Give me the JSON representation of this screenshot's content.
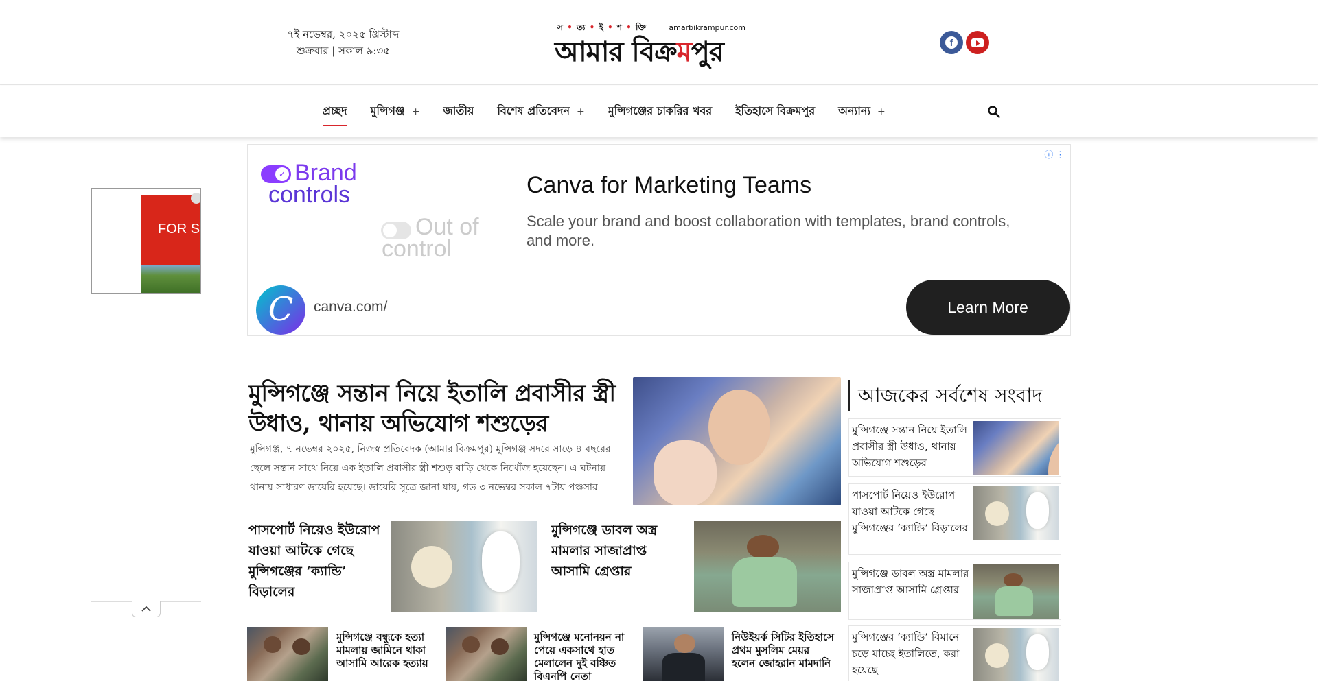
{
  "header": {
    "date_line": "৭ই নভেম্বর, ২০২৫ খ্রিস্টাব্দ",
    "time_line": "শুক্রবার | সকাল ৯:৩৫",
    "logo_tagline": [
      "স",
      "ত্য",
      "ই",
      "শ",
      "ক্তি"
    ],
    "logo_url": "amarbikrampur.com",
    "logo_text_a": "আমার বিক্র",
    "logo_text_b": "ম",
    "logo_text_c": "পুর",
    "social": [
      "facebook-icon",
      "youtube-icon"
    ]
  },
  "nav": {
    "items": [
      {
        "label": "প্রচ্ছদ",
        "plus": ""
      },
      {
        "label": "মুন্সিগঞ্জ",
        "plus": "+"
      },
      {
        "label": "জাতীয়",
        "plus": ""
      },
      {
        "label": "বিশেষ প্রতিবেদন",
        "plus": "+"
      },
      {
        "label": "মুন্সিগঞ্জের চাকরির খবর",
        "plus": ""
      },
      {
        "label": "ইতিহাসে বিক্রমপুর",
        "plus": ""
      },
      {
        "label": "অন্যান্য",
        "plus": "+"
      }
    ],
    "active_index": 0,
    "search_icon": "search-icon"
  },
  "side_ad": {
    "text": "FOR S"
  },
  "ad": {
    "brand_line1": "Brand",
    "brand_line2": "controls",
    "out_line1": "Out of",
    "out_line2": "control",
    "title": "Canva for Marketing Teams",
    "description": "Scale your brand and boost collaboration with templates, brand controls, and more.",
    "logo_letter": "C",
    "url": "canva.com/",
    "button": "Learn More",
    "info_icon": "ⓘ ⋮"
  },
  "lead": {
    "title": "মুন্সিগঞ্জে সন্তান নিয়ে ইতালি প্রবাসীর স্ত্রী উধাও, থানায় অভিযোগ শশুড়ের",
    "excerpt": "মুন্সিগঞ্জ, ৭ নভেম্বর ২০২৫, নিজস্ব প্রতিবেদক (আমার বিক্রমপুর) মুন্সিগঞ্জ সদরে সাড়ে ৪ বছরের ছেলে সন্তান সাথে নিয়ে এক ইতালি প্রবাসীর স্ত্রী শশুড় বাড়ি থেকে নিখোঁজ হয়েছেন। এ ঘটনায় থানায় সাধারণ ডায়েরি হয়েছে। ডায়েরি সূত্রে জানা যায়, গত ৩ নভেম্বর সকাল ৭টায় পঞ্চসার"
  },
  "cards": [
    {
      "title": "পাসপোর্ট নিয়েও ইউরোপ যাওয়া আটকে গেছে মুন্সিগঞ্জের ‘ক্যান্ডি’ বিড়ালের"
    },
    {
      "title": "মুন্সিগঞ্জে ডাবল অস্ত্র মামলার সাজাপ্রাপ্ত আসামি গ্রেপ্তার"
    }
  ],
  "mini_cards": [
    {
      "title": "মুন্সিগঞ্জে বন্ধুকে হত্যা মামলায় জামিনে থাকা আসামি আরেক হত্যায়"
    },
    {
      "title": "মুন্সিগঞ্জে মনোনয়ন না পেয়ে একসাথে হাত মেলালেন দুই বঞ্চিত বিএনপি নেতা"
    },
    {
      "title": "নিউইয়র্ক সিটির ইতিহাসে প্রথম মুসলিম মেয়র হলেন জোহরান মামদানি"
    }
  ],
  "latest": {
    "heading": "আজকের সর্বশেষ সংবাদ",
    "items": [
      {
        "title": "মুন্সিগঞ্জে সন্তান নিয়ে ইতালি প্রবাসীর স্ত্রী উধাও, থানায় অভিযোগ শশুড়ের"
      },
      {
        "title": "পাসপোর্ট নিয়েও ইউরোপ যাওয়া আটকে গেছে মুন্সিগঞ্জের ‘ক্যান্ডি’ বিড়ালের"
      },
      {
        "title": "মুন্সিগঞ্জে ডাবল অস্ত্র মামলার সাজাপ্রাপ্ত আসামি গ্রেপ্তার"
      },
      {
        "title": "মুন্সিগঞ্জের ‘ক্যান্ডি’ বিমানে চড়ে যাচ্ছে ইতালিতে, করা হয়েছে"
      }
    ]
  },
  "colors": {
    "accent": "#d8262c",
    "facebook": "#3b5998",
    "youtube": "#cd201f",
    "ad_button": "#202020"
  }
}
